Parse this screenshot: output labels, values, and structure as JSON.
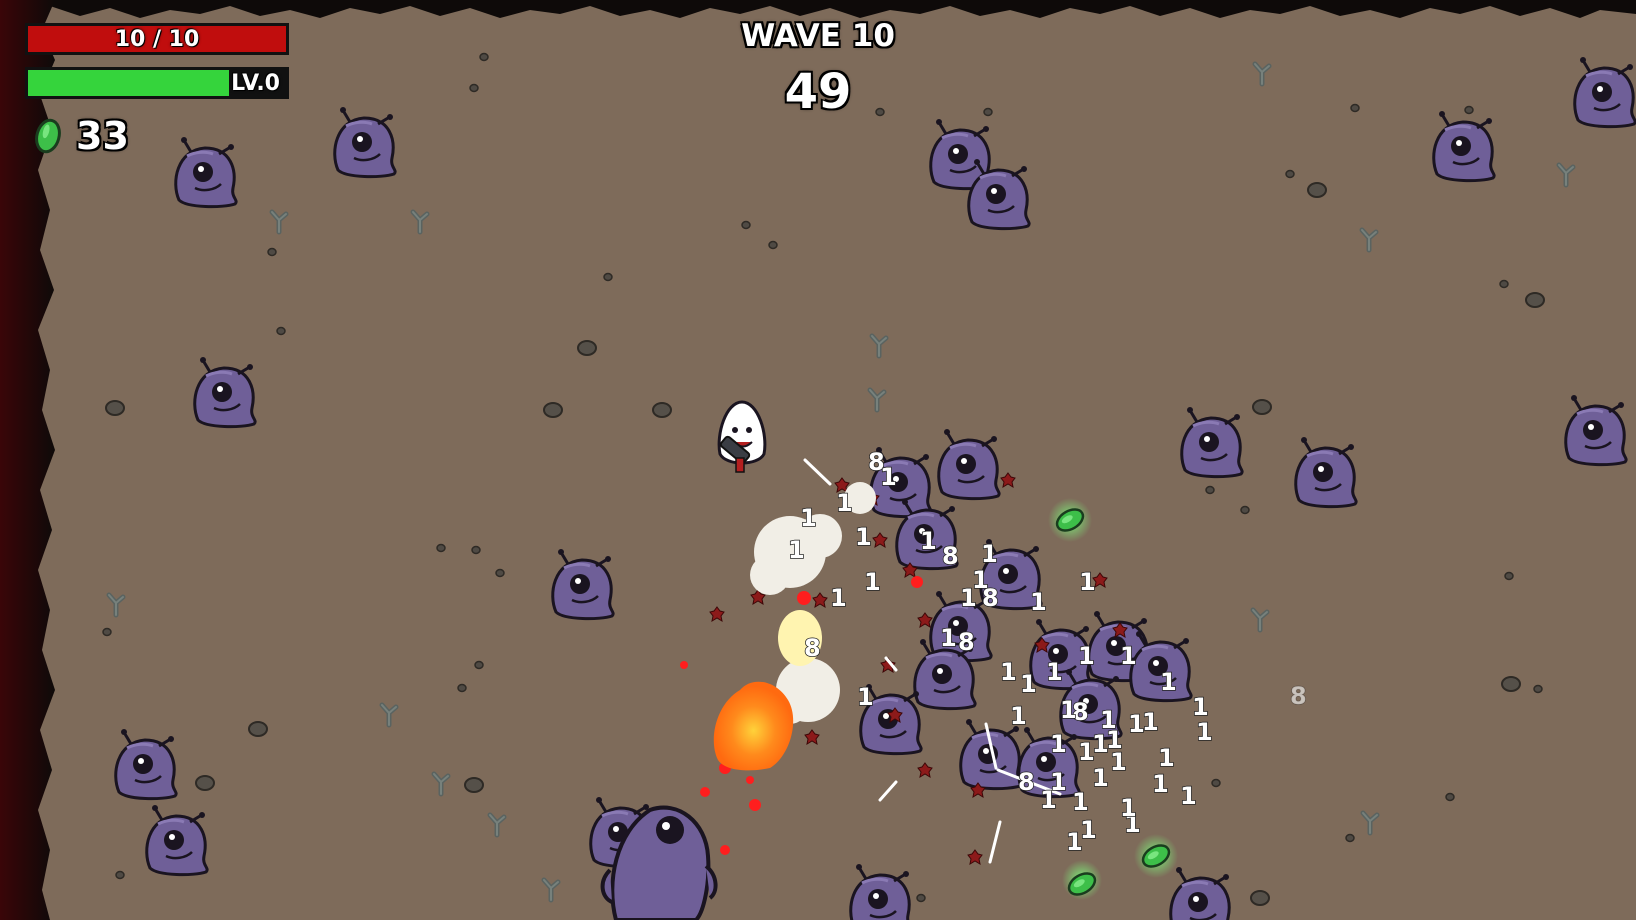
{
  "hud": {
    "hp_text": "10 / 10",
    "hp_fraction": 1.0,
    "xp_text": "LV.0",
    "xp_fraction": 0.78,
    "materials": "33",
    "wave_label": "WAVE 10",
    "timer": "49"
  },
  "colors": {
    "ground": "#7e6b5a",
    "hp_fill": "#c00d0d",
    "xp_fill": "#35d43c",
    "enemy_body": "#6f5f98",
    "material": "#3dbf49",
    "edge_dark": "#0e0a09",
    "edge_red": "#3a0508"
  },
  "icons": {
    "materials": "green-material-icon",
    "player": "potato-player-icon",
    "enemy": "purple-alien-baby-icon",
    "enemy_large": "purple-bruiser-icon",
    "weapon": "minigun-icon"
  },
  "damage_numbers": [
    "8",
    "1",
    "1",
    "1",
    "1",
    "1",
    "1",
    "1",
    "8",
    "1",
    "1",
    "1",
    "1",
    "8",
    "1",
    "1",
    "8",
    "1",
    "1",
    "1",
    "1",
    "1",
    "1",
    "1",
    "8",
    "1",
    "1",
    "1",
    "1",
    "1",
    "1",
    "1",
    "1",
    "8",
    "1",
    "1",
    "1",
    "8",
    "1",
    "1",
    "1",
    "1",
    "1",
    "1",
    "1",
    "1",
    "1",
    "1",
    "1",
    "1",
    "1",
    "8"
  ]
}
